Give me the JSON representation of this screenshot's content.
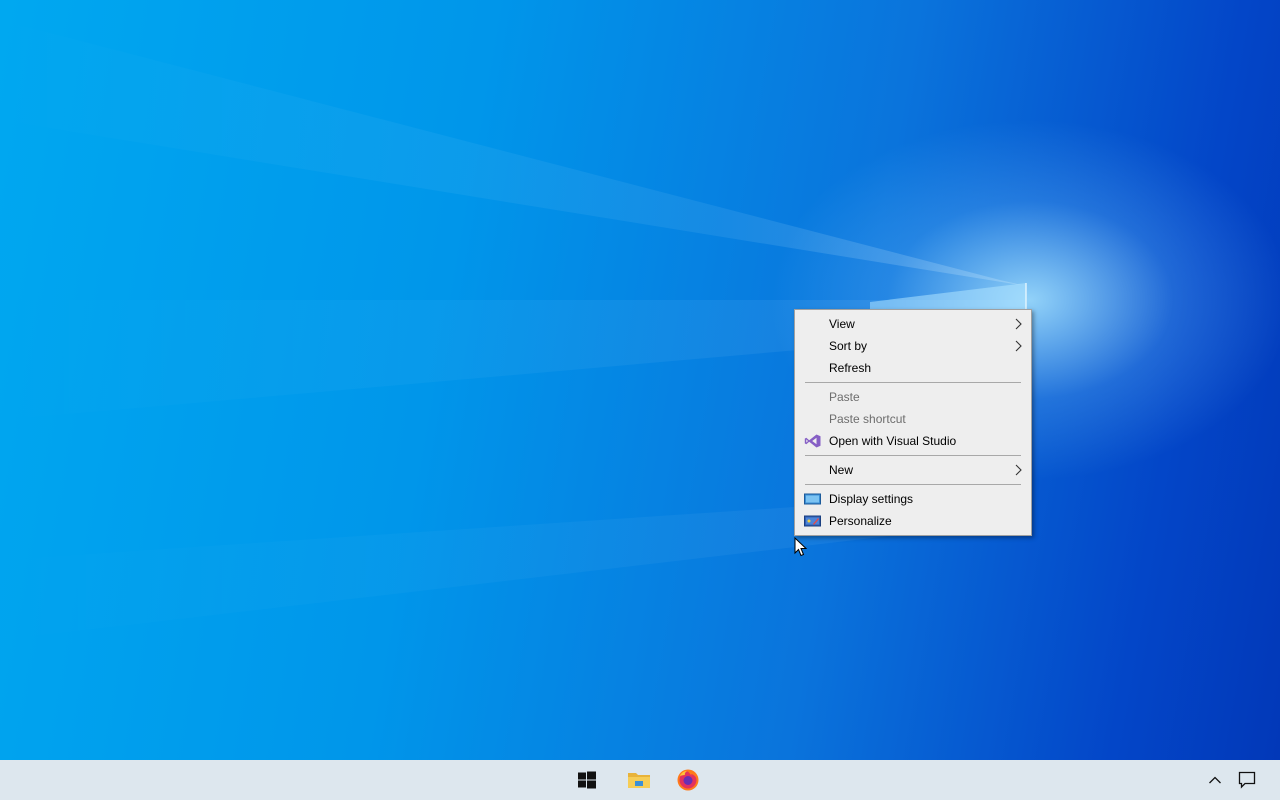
{
  "context_menu": {
    "items": [
      {
        "label": "View",
        "icon": "",
        "submenu": true,
        "disabled": false
      },
      {
        "label": "Sort by",
        "icon": "",
        "submenu": true,
        "disabled": false
      },
      {
        "label": "Refresh",
        "icon": "",
        "submenu": false,
        "disabled": false
      },
      {
        "label": "Paste",
        "icon": "",
        "submenu": false,
        "disabled": true
      },
      {
        "label": "Paste shortcut",
        "icon": "",
        "submenu": false,
        "disabled": true
      },
      {
        "label": "Open with Visual Studio",
        "icon": "visual-studio-icon",
        "submenu": false,
        "disabled": false
      },
      {
        "label": "New",
        "icon": "",
        "submenu": true,
        "disabled": false
      },
      {
        "label": "Display settings",
        "icon": "display-settings-icon",
        "submenu": false,
        "disabled": false
      },
      {
        "label": "Personalize",
        "icon": "personalize-icon",
        "submenu": false,
        "disabled": false
      }
    ]
  },
  "taskbar": {
    "apps": [
      {
        "name": "start",
        "icon": "windows-logo-icon"
      },
      {
        "name": "file-explorer",
        "icon": "folder-icon"
      },
      {
        "name": "firefox",
        "icon": "firefox-icon"
      }
    ],
    "tray": [
      {
        "name": "show-hidden-icons",
        "icon": "chevron-up-icon"
      },
      {
        "name": "action-center",
        "icon": "notification-icon"
      }
    ]
  },
  "colors": {
    "desktop_accent": "#0078d7",
    "menu_background": "#eeeeee",
    "taskbar_background": "#dde7ee",
    "disabled_text": "#6d6d6d"
  }
}
